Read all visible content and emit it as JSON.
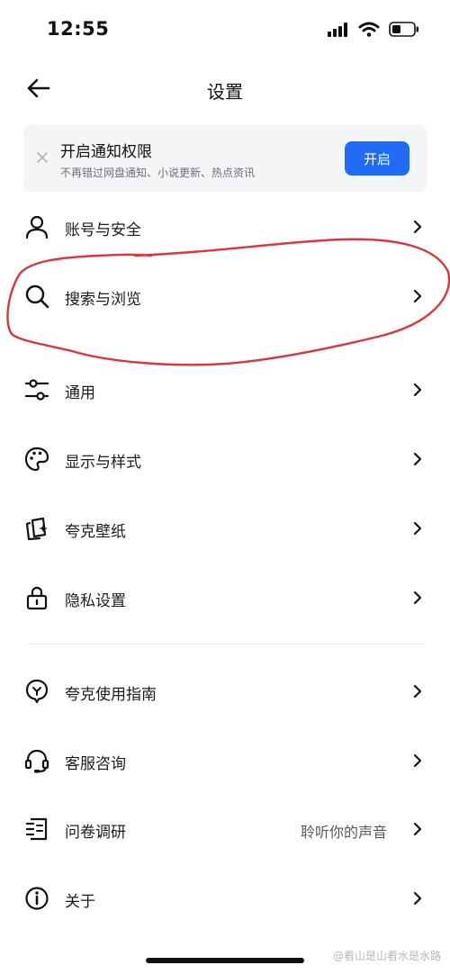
{
  "status_bar": {
    "time": "12:55",
    "icons": [
      "signal-icon",
      "wifi-icon",
      "battery-icon"
    ]
  },
  "nav": {
    "back_icon": "back-arrow-icon",
    "title": "设置"
  },
  "notice": {
    "title": "开启通知权限",
    "subtitle": "不再错过网盘通知、小说更新、热点资讯",
    "button": "开启",
    "button_color": "#1f6bf5"
  },
  "settings": {
    "items": [
      {
        "icon": "user-icon",
        "label": "账号与安全"
      },
      {
        "icon": "search-icon",
        "label": "搜索与浏览"
      },
      {
        "icon": "sliders-icon",
        "label": "通用"
      },
      {
        "icon": "palette-icon",
        "label": "显示与样式"
      },
      {
        "icon": "wallpaper-icon",
        "label": "夸克壁纸"
      },
      {
        "icon": "lock-icon",
        "label": "隐私设置"
      },
      {
        "icon": "lightbulb-icon",
        "label": "夸克使用指南"
      },
      {
        "icon": "headset-icon",
        "label": "客服咨询"
      },
      {
        "icon": "survey-icon",
        "label": "问卷调研",
        "value": "聆听你的声音"
      },
      {
        "icon": "info-icon",
        "label": "关于"
      }
    ]
  },
  "annotation_color": "#d9363e",
  "watermark": "@看山是山看水是水路"
}
